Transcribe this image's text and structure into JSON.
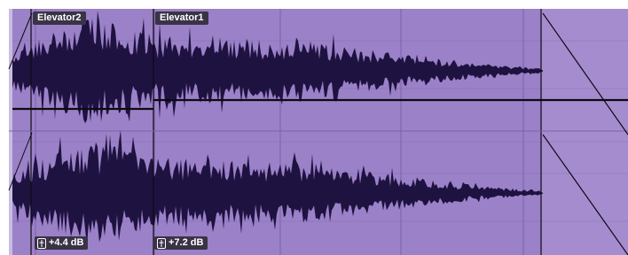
{
  "clips": [
    {
      "name": "Elevator2",
      "gain": "+4.4 dB"
    },
    {
      "name": "Elevator1",
      "gain": "+7.2 dB"
    }
  ],
  "icons": {
    "gain": "gain-handle-icon"
  },
  "colors": {
    "clip_background": "#9b81c7",
    "clip_background_light": "#a58ccf",
    "waveform": "#1e1240",
    "grid_line": "#7a64ab",
    "divider": "#0d0a12",
    "label_background": "#3a3346",
    "label_text": "#ffffff",
    "page_background": "#ffffff"
  }
}
